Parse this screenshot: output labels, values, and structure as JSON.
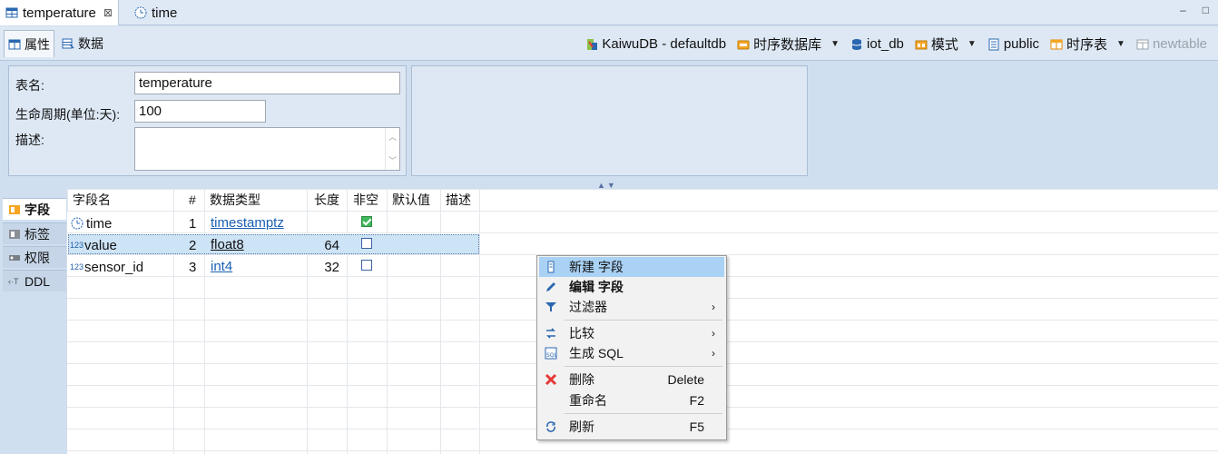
{
  "editor_tabs": [
    {
      "label": "temperature",
      "close": "⊠"
    },
    {
      "label": "time"
    }
  ],
  "window_controls": {
    "minimize": "–",
    "maximize": "□"
  },
  "sub_tabs": [
    {
      "label": "属性"
    },
    {
      "label": "数据"
    }
  ],
  "breadcrumbs": [
    {
      "label": "KaiwuDB - defaultdb"
    },
    {
      "label": "时序数据库",
      "dropdown": "▼"
    },
    {
      "label": "iot_db"
    },
    {
      "label": "模式",
      "dropdown": "▼"
    },
    {
      "label": "public"
    },
    {
      "label": "时序表",
      "dropdown": "▼"
    },
    {
      "label": "newtable"
    }
  ],
  "properties": {
    "table_name_label": "表名:",
    "table_name_value": "temperature",
    "lifecycle_label": "生命周期(单位:天):",
    "lifecycle_value": "100",
    "description_label": "描述:"
  },
  "side_tabs": [
    {
      "label": "字段"
    },
    {
      "label": "标签"
    },
    {
      "label": "权限"
    },
    {
      "label": "DDL"
    }
  ],
  "columns": {
    "name": "字段名",
    "index": "#",
    "type": "数据类型",
    "length": "长度",
    "not_null": "非空",
    "default": "默认值",
    "comment": "描述"
  },
  "rows": [
    {
      "name": "time",
      "type_prefix": "",
      "index": "1",
      "type": "timestamptz",
      "length": "",
      "not_null": true
    },
    {
      "name": "value",
      "type_prefix": "123",
      "index": "2",
      "type": "float8",
      "length": "64",
      "not_null": false
    },
    {
      "name": "sensor_id",
      "type_prefix": "123",
      "index": "3",
      "type": "int4",
      "length": "32",
      "not_null": false
    }
  ],
  "context_menu": {
    "new_field": "新建 字段",
    "edit_field": "编辑 字段",
    "filter": "过滤器",
    "compare": "比较",
    "generate_sql": "生成 SQL",
    "delete": "删除",
    "delete_accel": "Delete",
    "rename": "重命名",
    "rename_accel": "F2",
    "refresh": "刷新",
    "refresh_accel": "F5",
    "submenu_arrow": "›"
  },
  "splitter": "▲▼",
  "colors": {
    "accent": "#1a5fb4",
    "selection": "#cde4f7",
    "menu_highlight": "#a9d2f5",
    "panel": "#dde8f4"
  }
}
